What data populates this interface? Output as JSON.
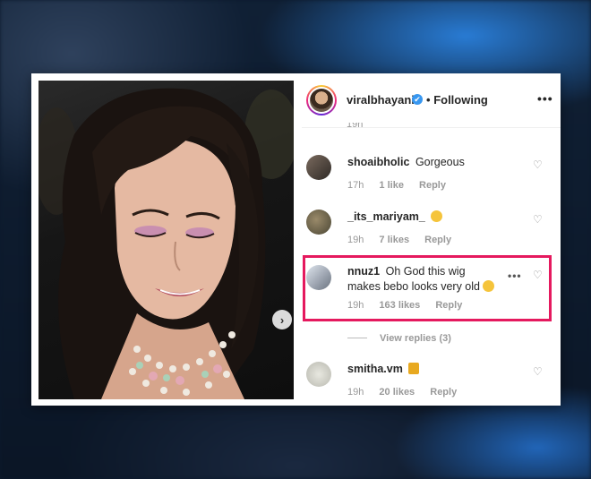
{
  "post": {
    "header": {
      "username": "viralbhayani",
      "verified_glyph": "✔",
      "separator": "•",
      "follow_status": "Following",
      "more_icon": "more-horizontal-icon"
    },
    "clipped_time": "19h",
    "photo_alt": "woman with long dark hair, pink eye makeup and layered pearl necklace",
    "next_icon": "chevron-right-icon"
  },
  "comments": [
    {
      "username": "shoaibholic",
      "text": "Gorgeous",
      "emoji": "",
      "time": "17h",
      "likes": "1 like",
      "reply": "Reply"
    },
    {
      "username": "_its_mariyam_",
      "text": "",
      "emoji": "confused-face-emoji",
      "time": "19h",
      "likes": "7 likes",
      "reply": "Reply"
    },
    {
      "username": "nnuz1",
      "text": "Oh God this wig makes bebo looks very old",
      "emoji": "grimace-emoji",
      "time": "19h",
      "likes": "163 likes",
      "reply": "Reply",
      "highlighted": true,
      "more_label": "•••"
    },
    {
      "username": "smitha.vm",
      "text": "",
      "emoji": "thumbs-down-emoji",
      "time": "19h",
      "likes": "20 likes",
      "reply": "Reply"
    }
  ],
  "view_replies": "View replies (3)",
  "colors": {
    "highlight": "#e5195e",
    "verified": "#3897f0"
  }
}
